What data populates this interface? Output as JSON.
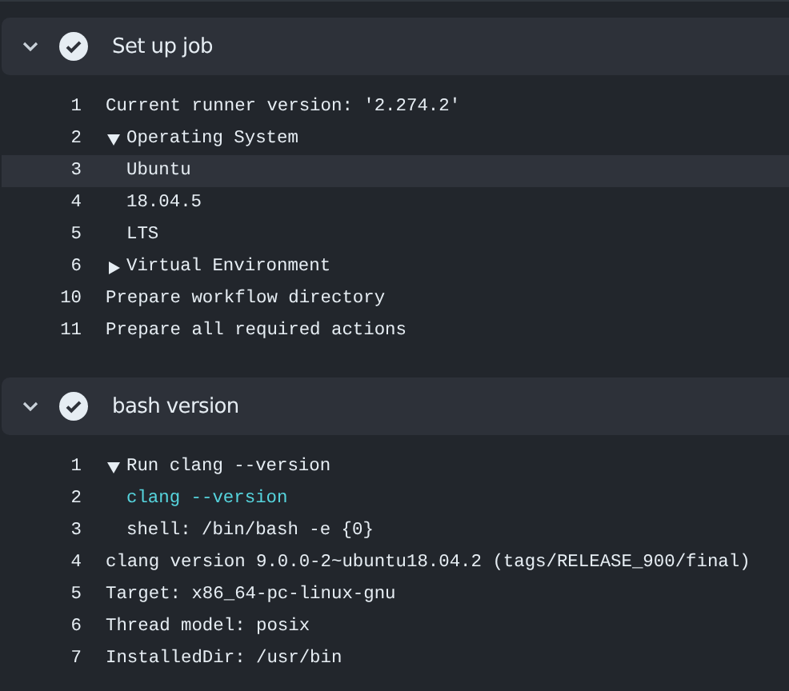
{
  "sections": [
    {
      "title": "Set up job",
      "expanded": true,
      "success": true,
      "lines": [
        {
          "number": "1",
          "text": "Current runner version: '2.274.2'",
          "kind": "text",
          "highlighted": false
        },
        {
          "number": "2",
          "text": "Operating System",
          "kind": "group",
          "expanded": true,
          "highlighted": false,
          "children": [
            {
              "number": "3",
              "text": "Ubuntu",
              "kind": "text",
              "highlighted": true
            },
            {
              "number": "4",
              "text": "18.04.5",
              "kind": "text",
              "highlighted": false
            },
            {
              "number": "5",
              "text": "LTS",
              "kind": "text",
              "highlighted": false
            }
          ]
        },
        {
          "number": "6",
          "text": "Virtual Environment",
          "kind": "group",
          "expanded": false,
          "highlighted": false
        },
        {
          "number": "10",
          "text": "Prepare workflow directory",
          "kind": "text",
          "highlighted": false
        },
        {
          "number": "11",
          "text": "Prepare all required actions",
          "kind": "text",
          "highlighted": false
        }
      ]
    },
    {
      "title": "bash version",
      "expanded": true,
      "success": true,
      "lines": [
        {
          "number": "1",
          "text": "Run clang --version",
          "kind": "group",
          "expanded": true,
          "highlighted": false,
          "children": [
            {
              "number": "2",
              "text": "clang --version",
              "kind": "command",
              "highlighted": false
            },
            {
              "number": "3",
              "text": "shell: /bin/bash -e {0}",
              "kind": "text",
              "highlighted": false
            }
          ]
        },
        {
          "number": "4",
          "text": "clang version 9.0.0-2~ubuntu18.04.2 (tags/RELEASE_900/final)",
          "kind": "text",
          "highlighted": false
        },
        {
          "number": "5",
          "text": "Target: x86_64-pc-linux-gnu",
          "kind": "text",
          "highlighted": false
        },
        {
          "number": "6",
          "text": "Thread model: posix",
          "kind": "text",
          "highlighted": false
        },
        {
          "number": "7",
          "text": "InstalledDir: /usr/bin",
          "kind": "text",
          "highlighted": false
        }
      ]
    }
  ]
}
